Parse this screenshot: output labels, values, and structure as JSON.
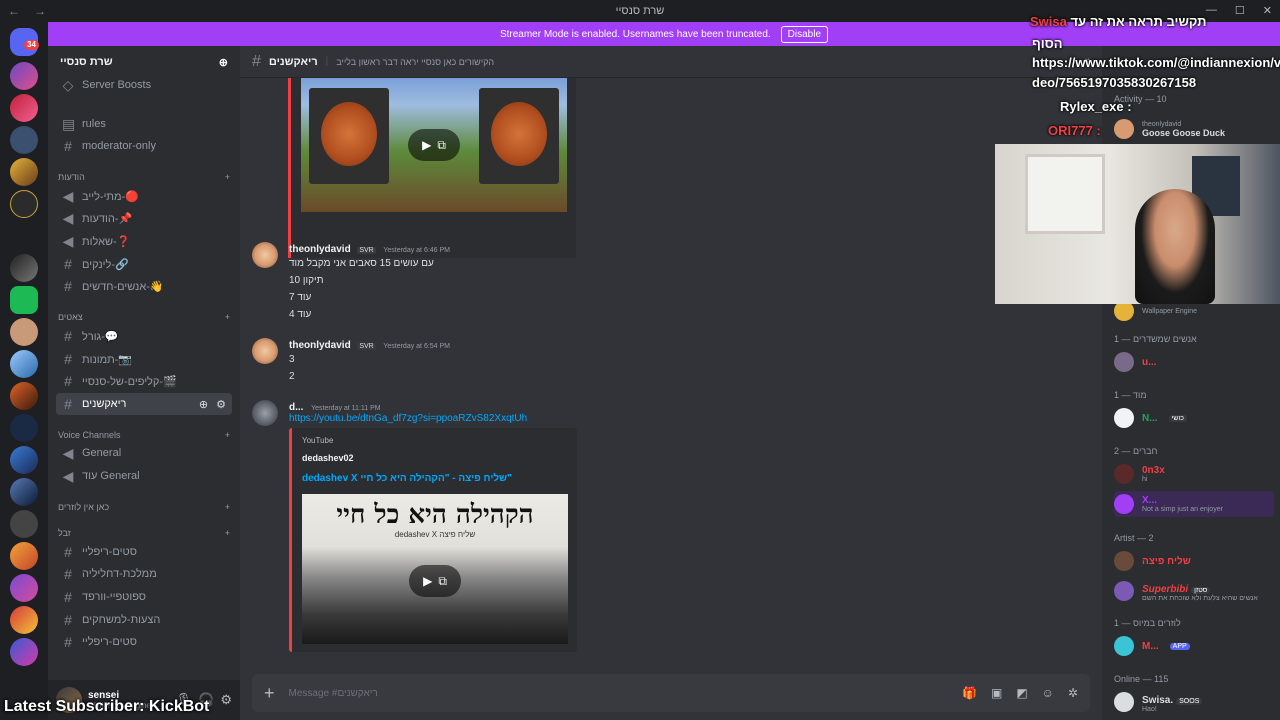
{
  "window": {
    "title": "שרת סנסיי"
  },
  "banner": {
    "text": "Streamer Mode is enabled. Usernames have been truncated.",
    "disable_label": "Disable"
  },
  "rail": {
    "notification_badge": "34"
  },
  "sidebar": {
    "server_name": "שרת סנסיי",
    "items": [
      {
        "label": "Server Boosts"
      },
      {
        "label": "rules"
      },
      {
        "label": "moderator-only"
      }
    ],
    "categories": [
      {
        "label": "הודעות"
      },
      {
        "label": "צאטים"
      },
      {
        "label": "Voice Channels"
      },
      {
        "label": "כאן אין לוזרים"
      },
      {
        "label": "זבל"
      }
    ],
    "announce_channels": [
      {
        "label": "מתי-לייב-🔴"
      },
      {
        "label": "הודעות-📌"
      },
      {
        "label": "שאלות-❓"
      },
      {
        "label": "לינקים-🔗"
      },
      {
        "label": "אנשים-חדשים-👋"
      }
    ],
    "chat_channels": [
      {
        "label": "גורל-💬"
      },
      {
        "label": "תמונות-📷"
      },
      {
        "label": "קליפים-של-סנסיי-🎬"
      },
      {
        "label": "ריאקשנים"
      }
    ],
    "voice_channels": [
      {
        "label": "General"
      },
      {
        "label": "עוד General"
      }
    ],
    "junk_channels": [
      {
        "label": "סטים-ריפליי"
      },
      {
        "label": "ממלכת-דחליליה"
      },
      {
        "label": "ספוטפיי-וורפד"
      },
      {
        "label": "הצעות-למשחקים"
      },
      {
        "label": "סטים-ריפליי"
      }
    ],
    "user": {
      "name": "sensei",
      "status": "Wallpaper Engine"
    }
  },
  "header": {
    "channel": "ריאקשנים",
    "topic": "הקישורים כאן סנסיי יראה דבר ראשון בלייב"
  },
  "messages": [
    {
      "author": "theonlydavid",
      "tag": "SVR",
      "time": "Yesterday at 6:46 PM",
      "lines": [
        "עם עושים 15 סאבים אני מקבל מוד",
        "תיקון 10",
        "עוד 7",
        "עוד 4"
      ]
    },
    {
      "author": "theonlydavid",
      "tag": "SVR",
      "time": "Yesterday at 6:54 PM",
      "lines": [
        "3",
        "2"
      ]
    },
    {
      "author": "d...",
      "time": "Yesterday at 11:11 PM",
      "link": "https://youtu.be/dtnGa_df7zg?si=ppoaRZvS82XxqtUh",
      "embed": {
        "provider": "YouTube",
        "author": "dedashev02",
        "title": "dedashev X שליח פיצה - \"הקהילה היא כל חיי\"",
        "thumb_big": "הקהילה היא כל חיי",
        "thumb_small": "dedashev X שליח פיצה"
      }
    }
  ],
  "composer": {
    "placeholder": "Message #ריאקשנים"
  },
  "members": {
    "activity": "Activity — 10",
    "activity_user": "theonlydavid",
    "activity_game": "Goose Goose Duck",
    "top_status": "Wallpaper Engine",
    "groups": [
      {
        "title": "אנשים שמשדרים — 1",
        "members": [
          {
            "name": "u...",
            "color": "#f23f43"
          }
        ]
      },
      {
        "title": "מוד — 1",
        "members": [
          {
            "name": "N...",
            "color": "#23a55a",
            "badge": "כושי"
          }
        ]
      },
      {
        "title": "חברים — 2",
        "members": [
          {
            "name": "0n3x",
            "color": "#f23f43",
            "sub": "hi"
          },
          {
            "name": "X...",
            "color": "#a13ff7",
            "sub": "Not a simp just an enjoyer"
          }
        ]
      },
      {
        "title": "Artist — 2",
        "members": [
          {
            "name": "שליח פיצה",
            "color": "#f23f43"
          },
          {
            "name": "Superbibi",
            "color": "#f23f43",
            "badge": "סטזן",
            "sub": "אנשים שהיא צלעת ולא שוכחת את השם"
          }
        ]
      },
      {
        "title": "לוזרים במיוס — 1",
        "members": [
          {
            "name": "M...",
            "color": "#f23f43",
            "badge": "APP"
          }
        ]
      },
      {
        "title": "Online — 115",
        "members": [
          {
            "name": "Swisa.",
            "color": "#dbdee1",
            "badge": "SOOS",
            "sub": "Hao!"
          }
        ]
      }
    ]
  },
  "overlay": {
    "line1": "תקשיב תראה את זה עד",
    "line1_user": "Swisa",
    "line2": "הסוף",
    "line3": "https://www.tiktok.com/@indiannexion/vi",
    "line4": "deo/7565197035830267158",
    "line5": "Rylex_exe :",
    "line6": "ORI777 :",
    "subscriber": "Latest Subscriber: KickBot"
  },
  "colors": {
    "accent": "#a13ff7",
    "embed_bar": "#f23f43",
    "link": "#00a8fc"
  }
}
